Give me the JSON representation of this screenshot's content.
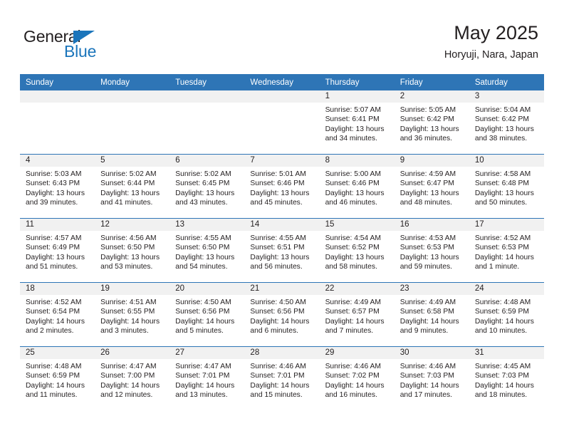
{
  "brand": {
    "name_part1": "General",
    "name_part2": "Blue",
    "accent_color": "#1b75bb"
  },
  "header": {
    "title": "May 2025",
    "subtitle": "Horyuji, Nara, Japan"
  },
  "theme": {
    "header_bar_color": "#2e75b6",
    "daynum_band_color": "#f1f1f1",
    "text_color": "#231f20"
  },
  "weekday_headers": [
    "Sunday",
    "Monday",
    "Tuesday",
    "Wednesday",
    "Thursday",
    "Friday",
    "Saturday"
  ],
  "labels": {
    "sunrise": "Sunrise:",
    "sunset": "Sunset:",
    "daylight": "Daylight:"
  },
  "weeks": [
    [
      {
        "day": "",
        "lines": [
          "",
          "",
          "",
          ""
        ]
      },
      {
        "day": "",
        "lines": [
          "",
          "",
          "",
          ""
        ]
      },
      {
        "day": "",
        "lines": [
          "",
          "",
          "",
          ""
        ]
      },
      {
        "day": "",
        "lines": [
          "",
          "",
          "",
          ""
        ]
      },
      {
        "day": "1",
        "lines": [
          "Sunrise: 5:07 AM",
          "Sunset: 6:41 PM",
          "Daylight: 13 hours",
          "and 34 minutes."
        ]
      },
      {
        "day": "2",
        "lines": [
          "Sunrise: 5:05 AM",
          "Sunset: 6:42 PM",
          "Daylight: 13 hours",
          "and 36 minutes."
        ]
      },
      {
        "day": "3",
        "lines": [
          "Sunrise: 5:04 AM",
          "Sunset: 6:42 PM",
          "Daylight: 13 hours",
          "and 38 minutes."
        ]
      }
    ],
    [
      {
        "day": "4",
        "lines": [
          "Sunrise: 5:03 AM",
          "Sunset: 6:43 PM",
          "Daylight: 13 hours",
          "and 39 minutes."
        ]
      },
      {
        "day": "5",
        "lines": [
          "Sunrise: 5:02 AM",
          "Sunset: 6:44 PM",
          "Daylight: 13 hours",
          "and 41 minutes."
        ]
      },
      {
        "day": "6",
        "lines": [
          "Sunrise: 5:02 AM",
          "Sunset: 6:45 PM",
          "Daylight: 13 hours",
          "and 43 minutes."
        ]
      },
      {
        "day": "7",
        "lines": [
          "Sunrise: 5:01 AM",
          "Sunset: 6:46 PM",
          "Daylight: 13 hours",
          "and 45 minutes."
        ]
      },
      {
        "day": "8",
        "lines": [
          "Sunrise: 5:00 AM",
          "Sunset: 6:46 PM",
          "Daylight: 13 hours",
          "and 46 minutes."
        ]
      },
      {
        "day": "9",
        "lines": [
          "Sunrise: 4:59 AM",
          "Sunset: 6:47 PM",
          "Daylight: 13 hours",
          "and 48 minutes."
        ]
      },
      {
        "day": "10",
        "lines": [
          "Sunrise: 4:58 AM",
          "Sunset: 6:48 PM",
          "Daylight: 13 hours",
          "and 50 minutes."
        ]
      }
    ],
    [
      {
        "day": "11",
        "lines": [
          "Sunrise: 4:57 AM",
          "Sunset: 6:49 PM",
          "Daylight: 13 hours",
          "and 51 minutes."
        ]
      },
      {
        "day": "12",
        "lines": [
          "Sunrise: 4:56 AM",
          "Sunset: 6:50 PM",
          "Daylight: 13 hours",
          "and 53 minutes."
        ]
      },
      {
        "day": "13",
        "lines": [
          "Sunrise: 4:55 AM",
          "Sunset: 6:50 PM",
          "Daylight: 13 hours",
          "and 54 minutes."
        ]
      },
      {
        "day": "14",
        "lines": [
          "Sunrise: 4:55 AM",
          "Sunset: 6:51 PM",
          "Daylight: 13 hours",
          "and 56 minutes."
        ]
      },
      {
        "day": "15",
        "lines": [
          "Sunrise: 4:54 AM",
          "Sunset: 6:52 PM",
          "Daylight: 13 hours",
          "and 58 minutes."
        ]
      },
      {
        "day": "16",
        "lines": [
          "Sunrise: 4:53 AM",
          "Sunset: 6:53 PM",
          "Daylight: 13 hours",
          "and 59 minutes."
        ]
      },
      {
        "day": "17",
        "lines": [
          "Sunrise: 4:52 AM",
          "Sunset: 6:53 PM",
          "Daylight: 14 hours",
          "and 1 minute."
        ]
      }
    ],
    [
      {
        "day": "18",
        "lines": [
          "Sunrise: 4:52 AM",
          "Sunset: 6:54 PM",
          "Daylight: 14 hours",
          "and 2 minutes."
        ]
      },
      {
        "day": "19",
        "lines": [
          "Sunrise: 4:51 AM",
          "Sunset: 6:55 PM",
          "Daylight: 14 hours",
          "and 3 minutes."
        ]
      },
      {
        "day": "20",
        "lines": [
          "Sunrise: 4:50 AM",
          "Sunset: 6:56 PM",
          "Daylight: 14 hours",
          "and 5 minutes."
        ]
      },
      {
        "day": "21",
        "lines": [
          "Sunrise: 4:50 AM",
          "Sunset: 6:56 PM",
          "Daylight: 14 hours",
          "and 6 minutes."
        ]
      },
      {
        "day": "22",
        "lines": [
          "Sunrise: 4:49 AM",
          "Sunset: 6:57 PM",
          "Daylight: 14 hours",
          "and 7 minutes."
        ]
      },
      {
        "day": "23",
        "lines": [
          "Sunrise: 4:49 AM",
          "Sunset: 6:58 PM",
          "Daylight: 14 hours",
          "and 9 minutes."
        ]
      },
      {
        "day": "24",
        "lines": [
          "Sunrise: 4:48 AM",
          "Sunset: 6:59 PM",
          "Daylight: 14 hours",
          "and 10 minutes."
        ]
      }
    ],
    [
      {
        "day": "25",
        "lines": [
          "Sunrise: 4:48 AM",
          "Sunset: 6:59 PM",
          "Daylight: 14 hours",
          "and 11 minutes."
        ]
      },
      {
        "day": "26",
        "lines": [
          "Sunrise: 4:47 AM",
          "Sunset: 7:00 PM",
          "Daylight: 14 hours",
          "and 12 minutes."
        ]
      },
      {
        "day": "27",
        "lines": [
          "Sunrise: 4:47 AM",
          "Sunset: 7:01 PM",
          "Daylight: 14 hours",
          "and 13 minutes."
        ]
      },
      {
        "day": "28",
        "lines": [
          "Sunrise: 4:46 AM",
          "Sunset: 7:01 PM",
          "Daylight: 14 hours",
          "and 15 minutes."
        ]
      },
      {
        "day": "29",
        "lines": [
          "Sunrise: 4:46 AM",
          "Sunset: 7:02 PM",
          "Daylight: 14 hours",
          "and 16 minutes."
        ]
      },
      {
        "day": "30",
        "lines": [
          "Sunrise: 4:46 AM",
          "Sunset: 7:03 PM",
          "Daylight: 14 hours",
          "and 17 minutes."
        ]
      },
      {
        "day": "31",
        "lines": [
          "Sunrise: 4:45 AM",
          "Sunset: 7:03 PM",
          "Daylight: 14 hours",
          "and 18 minutes."
        ]
      }
    ]
  ]
}
